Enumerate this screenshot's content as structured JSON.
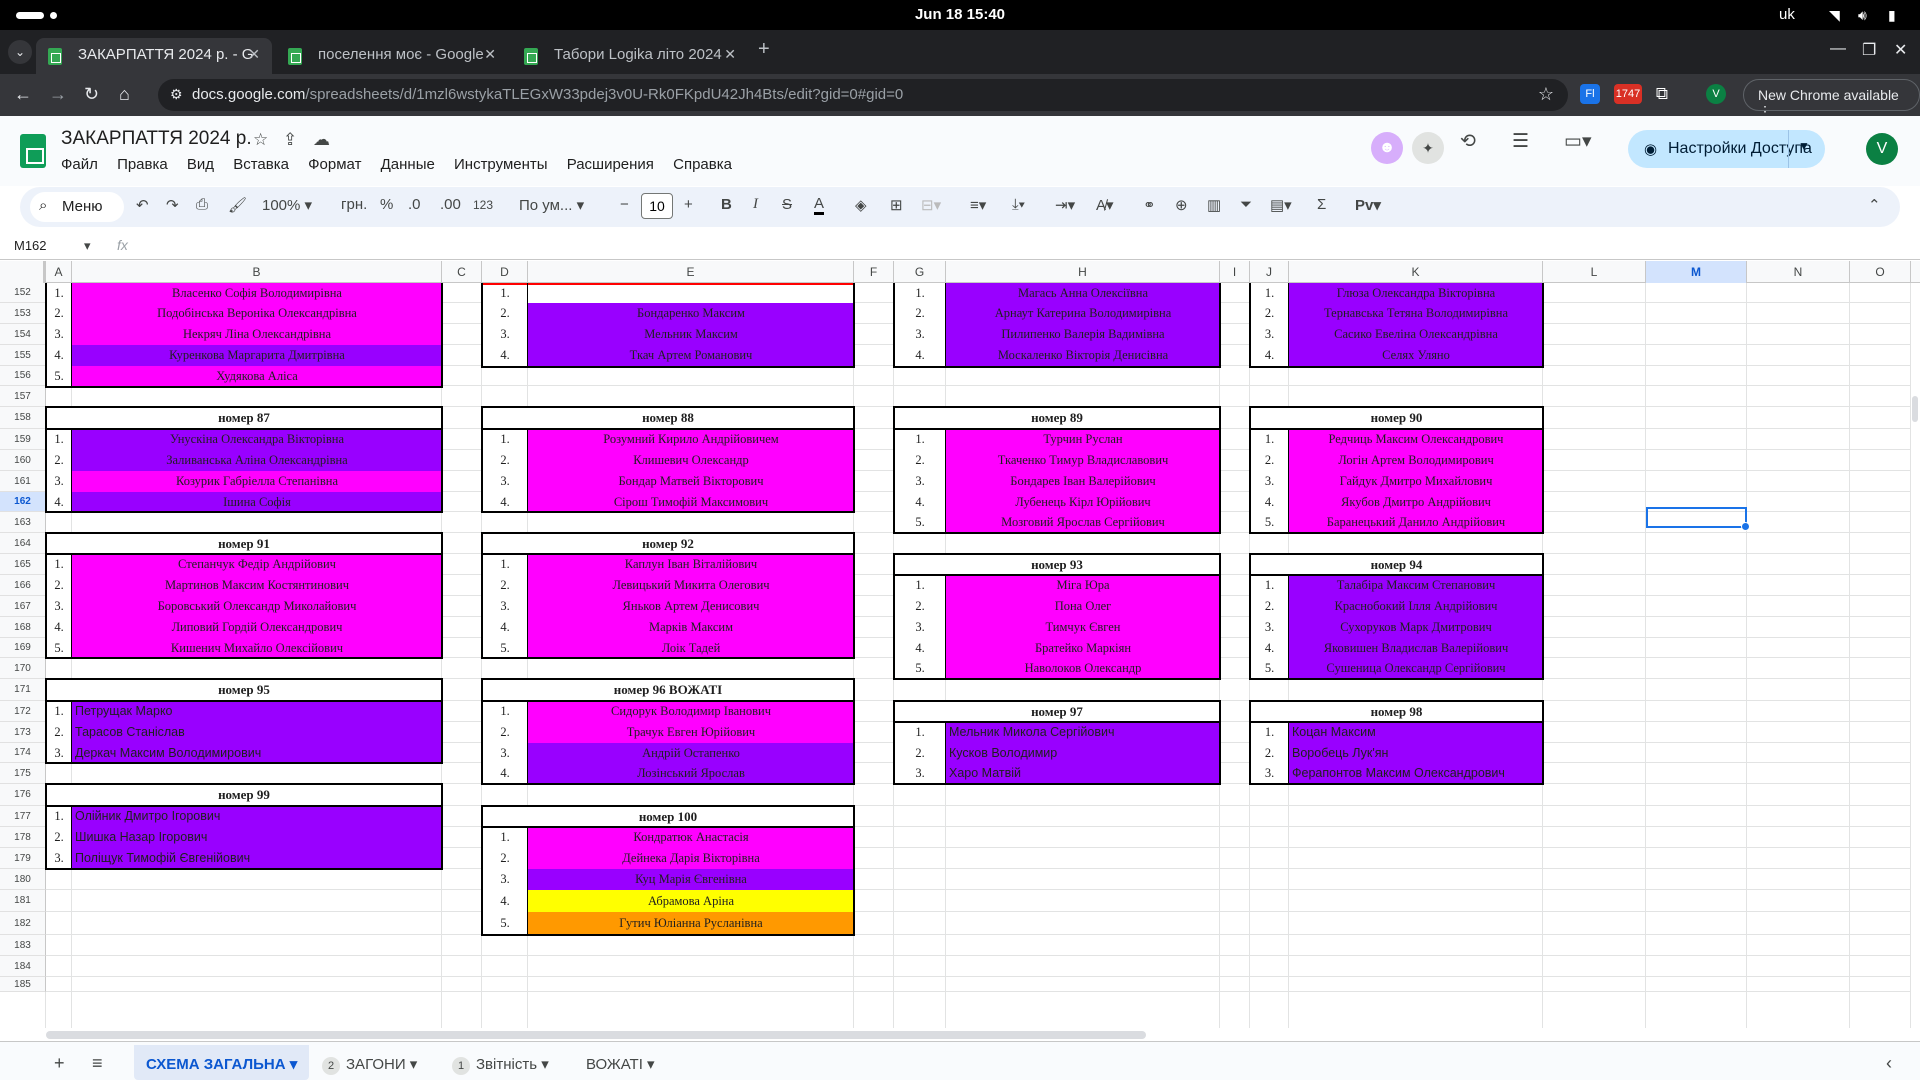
{
  "system": {
    "date_time": "Jun 18  15:40",
    "lang": "uk"
  },
  "browser": {
    "tabs": [
      {
        "title": "ЗАКАРПАТТЯ 2024 р. - G"
      },
      {
        "title": "поселення моє - Google"
      },
      {
        "title": "Табори Logika літо 2024"
      }
    ],
    "url_host": "docs.google.com",
    "url_path": "/spreadsheets/d/1mzl6wstykaTLEGxW33pdej3v0U-Rk0FKpdU42Jh4Bts/edit?gid=0#gid=0",
    "ext_badge": "1747",
    "ext_fl": "Fl",
    "profile_initial": "V",
    "new_chrome_label": "New Chrome available"
  },
  "app": {
    "doc_title": "ЗАКАРПАТТЯ 2024 р.",
    "menu": [
      "Файл",
      "Правка",
      "Вид",
      "Вставка",
      "Формат",
      "Данные",
      "Инструменты",
      "Расширения",
      "Справка"
    ],
    "share_label": "Настройки Доступа",
    "user_initial": "V"
  },
  "toolbar": {
    "search_label": "Меню",
    "zoom": "100%",
    "currency": "грн.",
    "percent": "%",
    "dec_minus": ".0",
    "dec_plus": ".00",
    "num_format": "123",
    "font": "По ум...",
    "font_size": "10"
  },
  "formula": {
    "name_box": "M162"
  },
  "columns": [
    "A",
    "B",
    "C",
    "D",
    "E",
    "F",
    "G",
    "H",
    "I",
    "J",
    "K",
    "L",
    "M",
    "N",
    "O"
  ],
  "rows": [
    "152",
    "153",
    "154",
    "155",
    "156",
    "157",
    "158",
    "159",
    "160",
    "161",
    "162",
    "163",
    "164",
    "165",
    "166",
    "167",
    "168",
    "169",
    "170",
    "171",
    "172",
    "173",
    "174",
    "175",
    "176",
    "177",
    "178",
    "179",
    "180",
    "181",
    "182",
    "183",
    "184",
    "185"
  ],
  "groups": [
    {
      "header": "",
      "members": [
        {
          "n": "1.",
          "name": "Власенко Софія Володимирівна",
          "color": "pink"
        },
        {
          "n": "2.",
          "name": "Подобінська Вероніка Олександрівна",
          "color": "pink"
        },
        {
          "n": "3.",
          "name": "Некряч Ліна Олександрівна",
          "color": "pink"
        },
        {
          "n": "4.",
          "name": "Куренкова Маргарита Дмитрівна",
          "color": "purp"
        },
        {
          "n": "5.",
          "name": "Худякова Аліса",
          "color": "pink"
        }
      ]
    },
    {
      "header": "",
      "members": [
        {
          "n": "1.",
          "name": "",
          "color": "white"
        },
        {
          "n": "2.",
          "name": "Бондаренко Максим",
          "color": "purp"
        },
        {
          "n": "3.",
          "name": "Мельник Максим",
          "color": "purp"
        },
        {
          "n": "4.",
          "name": "Ткач Артем Романович",
          "color": "purp"
        }
      ]
    },
    {
      "header": "",
      "members": [
        {
          "n": "1.",
          "name": "Магась Анна Олексіївна",
          "color": "purp"
        },
        {
          "n": "2.",
          "name": "Арнаут Катерина Володимирівна",
          "color": "purp"
        },
        {
          "n": "3.",
          "name": "Пилипенко Валерія Вадимівна",
          "color": "purp"
        },
        {
          "n": "4.",
          "name": "Москаленко Вікторія Денисівна",
          "color": "purp"
        }
      ]
    },
    {
      "header": "",
      "members": [
        {
          "n": "1.",
          "name": "Глюза Олександра Вікторівна",
          "color": "purp"
        },
        {
          "n": "2.",
          "name": "Тернавська Тетяна Володимирівна",
          "color": "purp"
        },
        {
          "n": "3.",
          "name": "Сасико Евеліна Олександрівна",
          "color": "purp"
        },
        {
          "n": "4.",
          "name": "Селях Уляно",
          "color": "purp"
        }
      ]
    },
    {
      "header": "номер 87",
      "members": [
        {
          "n": "1.",
          "name": "Унускіна Олександра Вікторівна",
          "color": "purp"
        },
        {
          "n": "2.",
          "name": "Заливанська Аліна Олександрівна",
          "color": "purp"
        },
        {
          "n": "3.",
          "name": "Козурик Габріелла Степанівна",
          "color": "pink"
        },
        {
          "n": "4.",
          "name": "Ішина Софія",
          "color": "purp"
        }
      ]
    },
    {
      "header": "номер 88",
      "members": [
        {
          "n": "1.",
          "name": "Розумний Кирило Андрійовичем",
          "color": "pink"
        },
        {
          "n": "2.",
          "name": "Клишевич Олександр",
          "color": "pink"
        },
        {
          "n": "3.",
          "name": "Бондар Матвей Вікторович",
          "color": "pink"
        },
        {
          "n": "4.",
          "name": "Сірош Тимофій Максимович",
          "color": "pink"
        }
      ]
    },
    {
      "header": "номер 89",
      "members": [
        {
          "n": "1.",
          "name": "Турчин Руслан",
          "color": "pink"
        },
        {
          "n": "2.",
          "name": "Ткаченко Тимур Владиславович",
          "color": "pink"
        },
        {
          "n": "3.",
          "name": "Бондарев Іван Валерійович",
          "color": "pink"
        },
        {
          "n": "4.",
          "name": "Лубенець Кірл Юрійович",
          "color": "pink"
        },
        {
          "n": "5.",
          "name": "Мозговий Ярослав Сергійович",
          "color": "pink"
        }
      ]
    },
    {
      "header": "номер 90",
      "members": [
        {
          "n": "1.",
          "name": "Редчиць Максим Олександрович",
          "color": "pink"
        },
        {
          "n": "2.",
          "name": "Логін Артем Володимирович",
          "color": "pink"
        },
        {
          "n": "3.",
          "name": "Гайдук Дмитро Михайлович",
          "color": "pink"
        },
        {
          "n": "4.",
          "name": "Якубов Дмитро Андрійович",
          "color": "pink"
        },
        {
          "n": "5.",
          "name": "Баранецький Данило Андрійович",
          "color": "pink"
        }
      ]
    },
    {
      "header": "номер 91",
      "members": [
        {
          "n": "1.",
          "name": "Степанчук Федір Андрійович",
          "color": "pink"
        },
        {
          "n": "2.",
          "name": "Мартинов Максим Костянтинович",
          "color": "pink"
        },
        {
          "n": "3.",
          "name": "Боровський Олександр Миколайович",
          "color": "pink"
        },
        {
          "n": "4.",
          "name": "Липовий Гордій Олександрович",
          "color": "pink"
        },
        {
          "n": "5.",
          "name": "Кишенич Михайло Олексійович",
          "color": "pink"
        }
      ]
    },
    {
      "header": "номер 92",
      "members": [
        {
          "n": "1.",
          "name": "Каплун Іван Віталійович",
          "color": "pink"
        },
        {
          "n": "2.",
          "name": "Левицький Микита Олегович",
          "color": "pink"
        },
        {
          "n": "3.",
          "name": "Яньков Артем Денисович",
          "color": "pink"
        },
        {
          "n": "4.",
          "name": "Марків Максим",
          "color": "pink"
        },
        {
          "n": "5.",
          "name": "Лоік Тадей",
          "color": "pink"
        }
      ]
    },
    {
      "header": "номер 93",
      "members": [
        {
          "n": "1.",
          "name": "Міга Юра",
          "color": "pink"
        },
        {
          "n": "2.",
          "name": "Пона Олег",
          "color": "pink"
        },
        {
          "n": "3.",
          "name": "Тимчук Євген",
          "color": "pink"
        },
        {
          "n": "4.",
          "name": "Братейко Маркіян",
          "color": "pink"
        },
        {
          "n": "5.",
          "name": "Наволоков Олександр",
          "color": "pink"
        }
      ]
    },
    {
      "header": "номер 94",
      "members": [
        {
          "n": "1.",
          "name": "Талабіра Максим Степанович",
          "color": "purp"
        },
        {
          "n": "2.",
          "name": "Краснобокий Ілля Андрійович",
          "color": "purp"
        },
        {
          "n": "3.",
          "name": "Сухоруков Марк Дмитрович",
          "color": "purp"
        },
        {
          "n": "4.",
          "name": "Яковишен Владислав Валерійович",
          "color": "purp"
        },
        {
          "n": "5.",
          "name": "Сушеница Олександр Сергійович",
          "color": "purp"
        }
      ]
    },
    {
      "header": "номер 95",
      "members": [
        {
          "n": "1.",
          "name": "Петрущак Марко",
          "color": "purp"
        },
        {
          "n": "2.",
          "name": "Тарасов Станіслав",
          "color": "purp"
        },
        {
          "n": "3.",
          "name": "Деркач Максим Володимирович",
          "color": "purp"
        }
      ]
    },
    {
      "header": "номер 96 ВОЖАТІ",
      "members": [
        {
          "n": "1.",
          "name": "Сидорук Володимир Іванович",
          "color": "pink"
        },
        {
          "n": "2.",
          "name": "Трачук Евген Юрійович",
          "color": "pink"
        },
        {
          "n": "3.",
          "name": "Андрій Остапенко",
          "color": "purp"
        },
        {
          "n": "4.",
          "name": "Лозінський Ярослав",
          "color": "purp"
        }
      ]
    },
    {
      "header": "номер 97",
      "members": [
        {
          "n": "1.",
          "name": "Мельник Микола Сергійович",
          "color": "purp"
        },
        {
          "n": "2.",
          "name": "Кусков Володимир",
          "color": "purp"
        },
        {
          "n": "3.",
          "name": "Харо Матвій",
          "color": "purp"
        }
      ]
    },
    {
      "header": "номер 98",
      "members": [
        {
          "n": "1.",
          "name": "Коцан Максим",
          "color": "purp"
        },
        {
          "n": "2.",
          "name": "Воробець Лук'ян",
          "color": "purp"
        },
        {
          "n": "3.",
          "name": "Ферапонтов Максим Олександрович",
          "color": "purp"
        }
      ]
    },
    {
      "header": "номер 99",
      "members": [
        {
          "n": "1.",
          "name": "Олійник Дмитро Ігорович",
          "color": "purp"
        },
        {
          "n": "2.",
          "name": "Шишка Назар Ігорович",
          "color": "purp"
        },
        {
          "n": "3.",
          "name": "Поліщук Тимофій Євгенійович",
          "color": "purp"
        }
      ]
    },
    {
      "header": "номер 100",
      "members": [
        {
          "n": "1.",
          "name": "Кондратюк Анастасія",
          "color": "pink"
        },
        {
          "n": "2.",
          "name": "Дейнека Дарія Вікторівна",
          "color": "pink"
        },
        {
          "n": "3.",
          "name": "Куц Марія Євгенівна",
          "color": "purp"
        },
        {
          "n": "4.",
          "name": "Абрамова Аріна",
          "color": "yellow"
        },
        {
          "n": "5.",
          "name": "Гутич Юліанна Русланівна",
          "color": "orange"
        }
      ]
    }
  ],
  "sheets": [
    {
      "label": "СХЕМА ЗАГАЛЬНА",
      "badge": ""
    },
    {
      "label": "ЗАГОНИ",
      "badge": "2"
    },
    {
      "label": "Звітність",
      "badge": "1"
    },
    {
      "label": "ВОЖАТІ",
      "badge": ""
    }
  ],
  "colors": {
    "pink": "#ff00ff",
    "purple": "#9900ff",
    "yellow": "#ffff00",
    "orange": "#ff9900",
    "header_red": "#ff0000"
  }
}
